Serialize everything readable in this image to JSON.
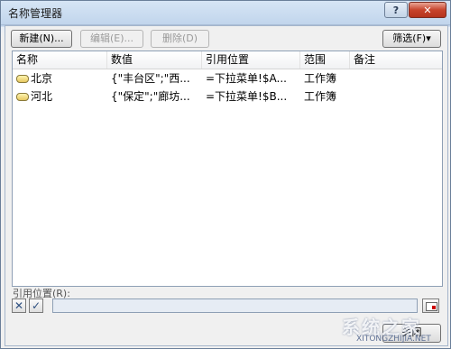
{
  "window": {
    "title": "名称管理器",
    "help_label": "?",
    "close_glyph": "✕"
  },
  "toolbar": {
    "new_label": "新建(N)...",
    "edit_label": "编辑(E)...",
    "delete_label": "删除(D)",
    "filter_label": "筛选(F)▾"
  },
  "table": {
    "columns": [
      "名称",
      "数值",
      "引用位置",
      "范围",
      "备注"
    ],
    "rows": [
      {
        "name": "北京",
        "value": "{\"丰台区\";\"西...",
        "refers_to": "=下拉菜单!$A...",
        "scope": "工作簿",
        "comment": ""
      },
      {
        "name": "河北",
        "value": "{\"保定\";\"廊坊...",
        "refers_to": "=下拉菜单!$B...",
        "scope": "工作簿",
        "comment": ""
      }
    ]
  },
  "reference": {
    "label": "引用位置(R):",
    "cancel_glyph": "✕",
    "confirm_glyph": "✓",
    "value": ""
  },
  "footer": {
    "close_label": "关闭"
  },
  "watermark": {
    "text": "系统之家",
    "url": "XITONGZHIJIA.NET"
  }
}
